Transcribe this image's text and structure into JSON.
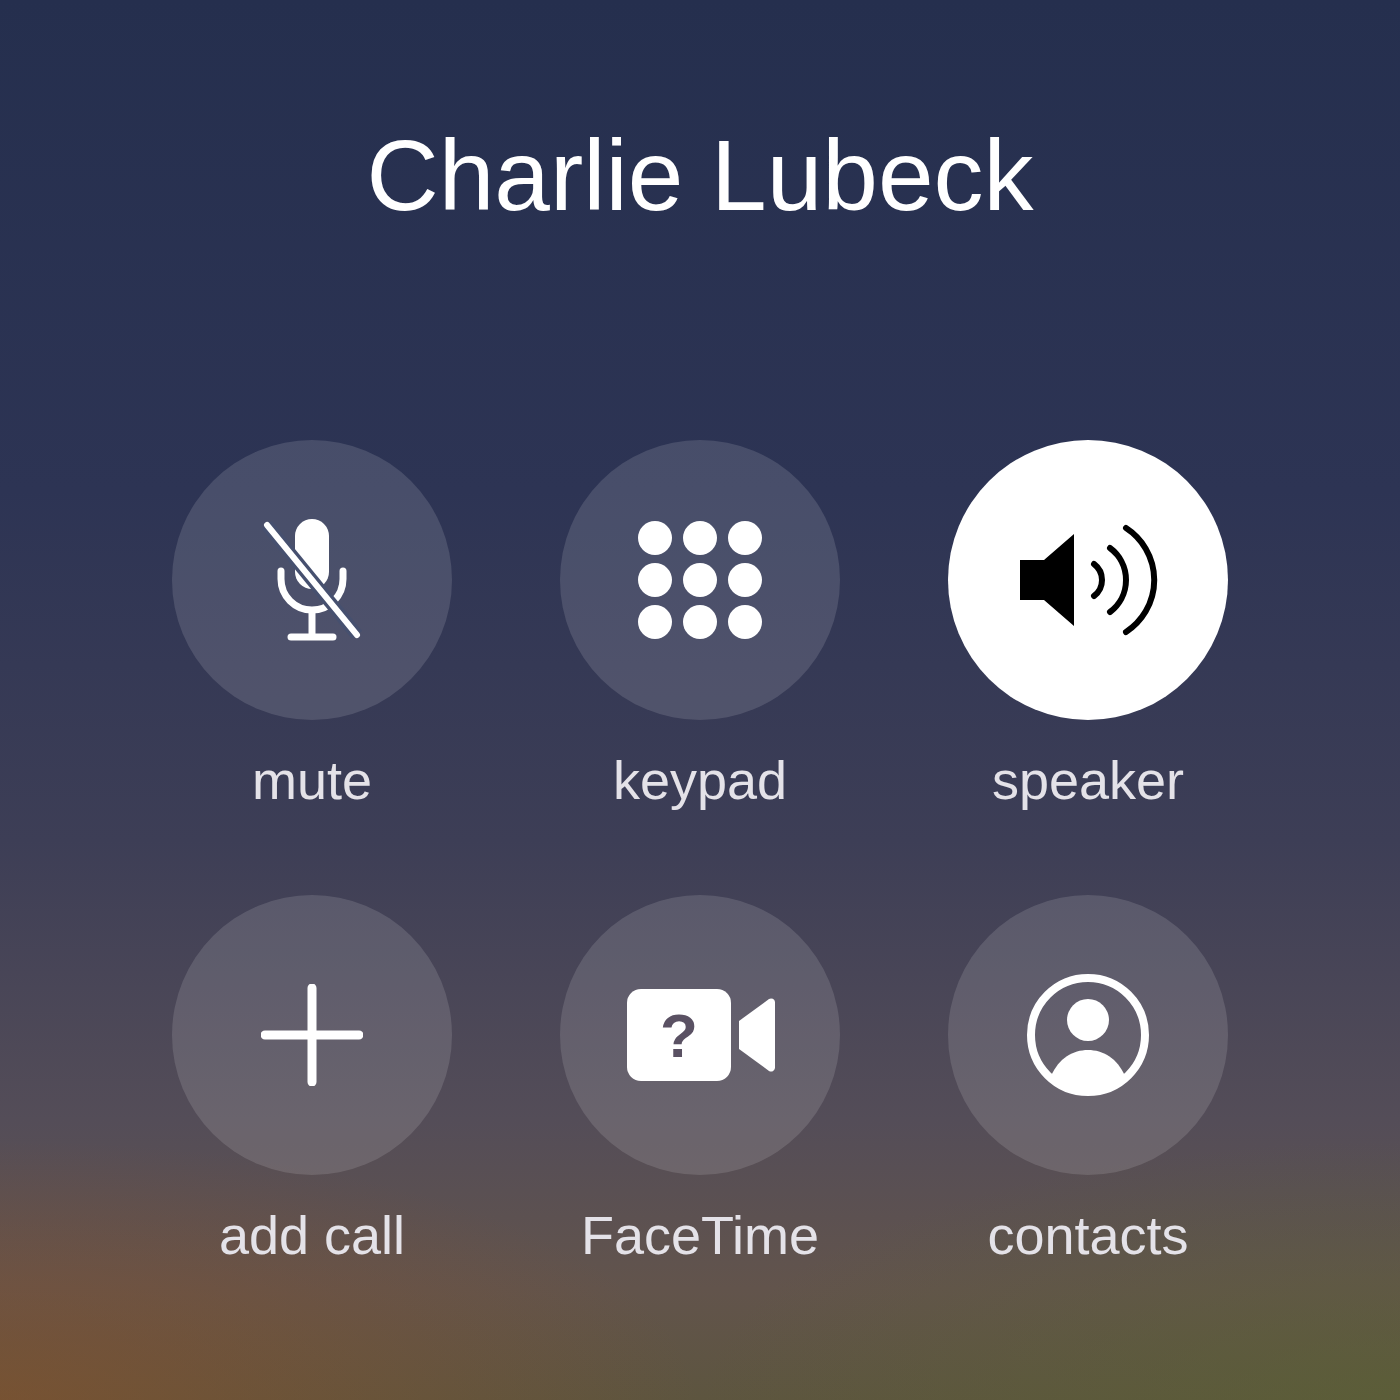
{
  "caller": {
    "name": "Charlie Lubeck"
  },
  "buttons": [
    {
      "kind": "mute",
      "label": "mute",
      "on": false
    },
    {
      "kind": "keypad",
      "label": "keypad",
      "on": false
    },
    {
      "kind": "speaker",
      "label": "speaker",
      "on": true
    },
    {
      "kind": "add",
      "label": "add call",
      "on": false
    },
    {
      "kind": "facetime",
      "label": "FaceTime",
      "on": false,
      "icon_text": "?"
    },
    {
      "kind": "contacts",
      "label": "contacts",
      "on": false
    }
  ]
}
